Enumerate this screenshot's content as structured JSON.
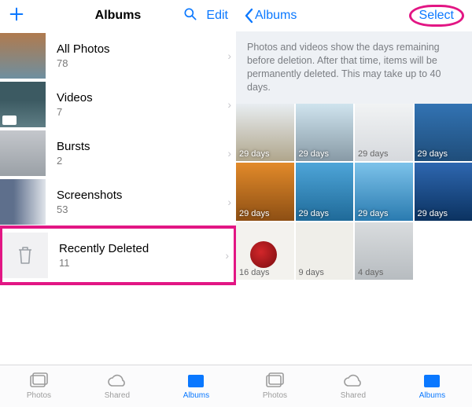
{
  "left": {
    "title": "Albums",
    "edit": "Edit",
    "albums": [
      {
        "name": "All Photos",
        "count": "78"
      },
      {
        "name": "Videos",
        "count": "7"
      },
      {
        "name": "Bursts",
        "count": "2"
      },
      {
        "name": "Screenshots",
        "count": "53"
      },
      {
        "name": "Recently Deleted",
        "count": "11"
      }
    ]
  },
  "right": {
    "back": "Albums",
    "select": "Select",
    "info": "Photos and videos show the days remaining before deletion. After that time, items will be permanently deleted. This may take up to 40 days.",
    "cells": [
      {
        "days": "29 days"
      },
      {
        "days": "29 days"
      },
      {
        "days": "29 days"
      },
      {
        "days": "29 days"
      },
      {
        "days": "29 days"
      },
      {
        "days": "29 days"
      },
      {
        "days": "29 days"
      },
      {
        "days": "29 days"
      },
      {
        "days": "16 days"
      },
      {
        "days": "9 days"
      },
      {
        "days": "4 days"
      }
    ]
  },
  "tabs": {
    "photos": "Photos",
    "shared": "Shared",
    "albums": "Albums"
  }
}
